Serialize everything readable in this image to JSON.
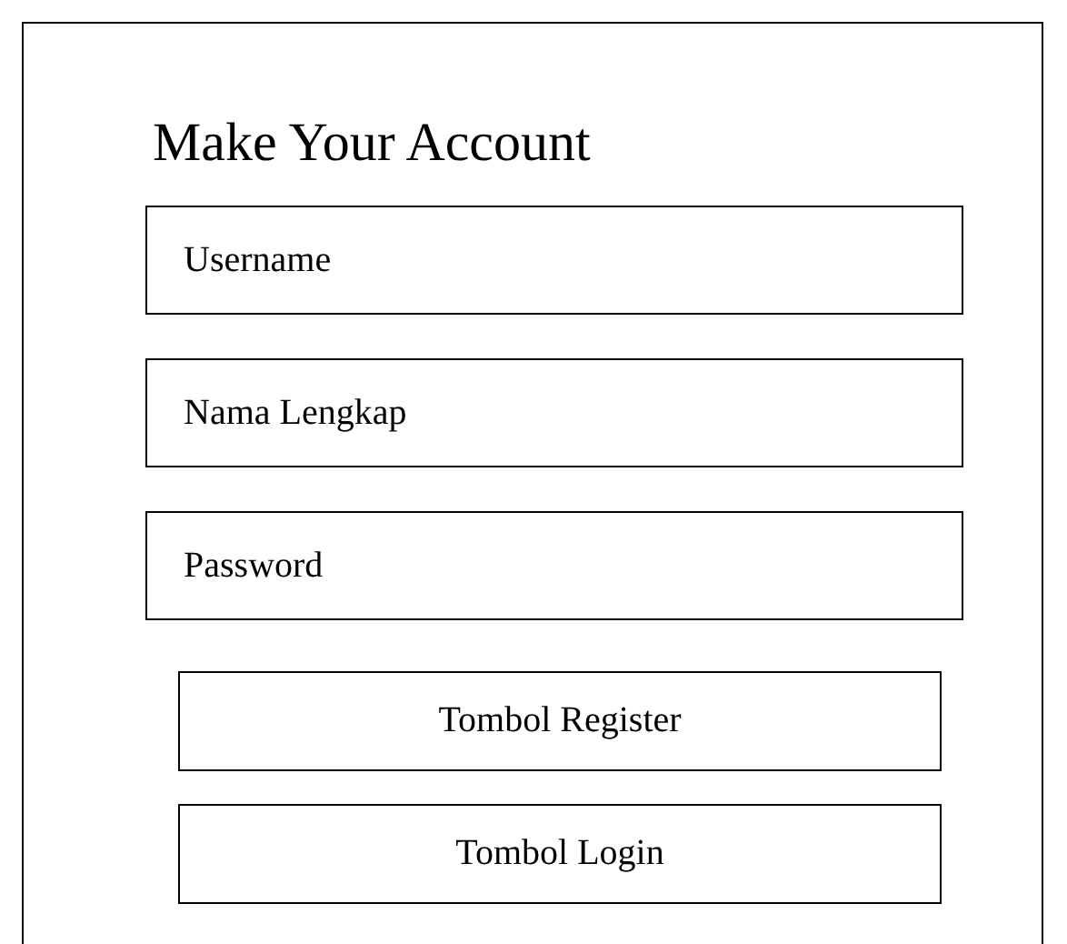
{
  "title": "Make Your Account",
  "fields": [
    {
      "placeholder": "Username"
    },
    {
      "placeholder": "Nama Lengkap"
    },
    {
      "placeholder": "Password"
    }
  ],
  "buttons": [
    "Tombol Register",
    "Tombol Login"
  ]
}
